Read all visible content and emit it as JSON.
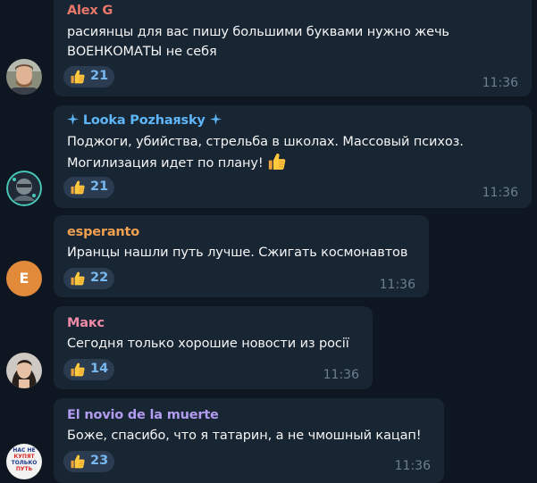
{
  "messages": [
    {
      "author": "Alex G",
      "author_color": "#e8786a",
      "lines": [
        "расиянцы для вас пишу большими буквами нужно жечь",
        "ВОЕНКОМАТЫ не себя"
      ],
      "reaction": {
        "icon": "thumbs-up-icon",
        "count": "21"
      },
      "time": "11:36"
    },
    {
      "author": "Looka Pozhaяsky",
      "author_color": "#5eb5f7",
      "lines": [
        "Поджоги, убийства, стрельба в школах. Массовый психоз.",
        "Могилизация идет по плану!"
      ],
      "reaction": {
        "icon": "thumbs-up-icon",
        "count": "21"
      },
      "time": "11:36"
    },
    {
      "author": "esperanto",
      "author_color": "#f0a050",
      "avatar_letter": "E",
      "lines": [
        "Иранцы нашли путь лучше. Сжигать космонавтов"
      ],
      "reaction": {
        "icon": "thumbs-up-icon",
        "count": "22"
      },
      "time": "11:36"
    },
    {
      "author": "Макс",
      "author_color": "#f08aa8",
      "lines": [
        "Сегодня только хорошие новости из росії"
      ],
      "reaction": {
        "icon": "thumbs-up-icon",
        "count": "14"
      },
      "time": "11:36"
    },
    {
      "author": "El novio de la muerte",
      "author_color": "#b29cf0",
      "avatar_text": [
        "НАС НЕ",
        "КУПЯТ",
        "ТОЛЬКО",
        "ПУТЬ"
      ],
      "lines": [
        "Боже, спасибо, что я татарин, а не чмошный кацап!"
      ],
      "reaction": {
        "icon": "thumbs-up-icon",
        "count": "23"
      },
      "time": "11:36"
    }
  ],
  "colors": {
    "background": "#0e1621",
    "bubble": "#182533",
    "reaction_bg": "#2b3c50",
    "reaction_count": "#78b8f0",
    "time": "#6d7f8f",
    "text": "#f5f5f5"
  }
}
